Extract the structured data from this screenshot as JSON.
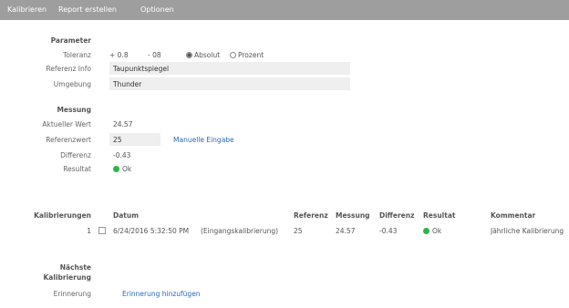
{
  "menu": {
    "calibrate": "Kalibrieren",
    "report": "Report erstellen",
    "options": "Optionen"
  },
  "parameter": {
    "heading": "Parameter",
    "tolerance_label": "Toleranz",
    "tol_plus": "+ 0.8",
    "tol_minus": "- 08",
    "absolute_label": "Absolut",
    "percent_label": "Prozent",
    "selected_mode": "absolute",
    "reference_info_label": "Referenz Info",
    "reference_info_value": "Taupunktspiegel",
    "environment_label": "Umgebung",
    "environment_value": "Thunder"
  },
  "measurement": {
    "heading": "Messung",
    "actual_label": "Aktueller Wert",
    "actual_value": "24.57",
    "reference_label": "Referenzwert",
    "reference_value": "25",
    "manual_entry_link": "Manuelle Eingabe",
    "difference_label": "Differenz",
    "difference_value": "-0.43",
    "result_label": "Resultat",
    "result_value": "Ok",
    "ok_color": "#2db34a"
  },
  "calibrations": {
    "heading": "Kalibrierungen",
    "columns": {
      "date": "Datum",
      "reference": "Referenz",
      "measurement": "Messung",
      "difference": "Differenz",
      "result": "Resultat",
      "comment": "Kommentar"
    },
    "rows": [
      {
        "index": "1",
        "date": "6/24/2016 5:32:50 PM",
        "type": "(Eingangskalibrierung)",
        "reference": "25",
        "measurement": "24.57",
        "difference": "-0.43",
        "result": "Ok",
        "comment": "Jährliche Kalibrierung"
      }
    ]
  },
  "next_calibration": {
    "heading_line1": "Nächste",
    "heading_line2": "Kalibrierung",
    "reminder_label": "Erinnerung",
    "add_reminder_link": "Erinnerung hinzufügen"
  }
}
